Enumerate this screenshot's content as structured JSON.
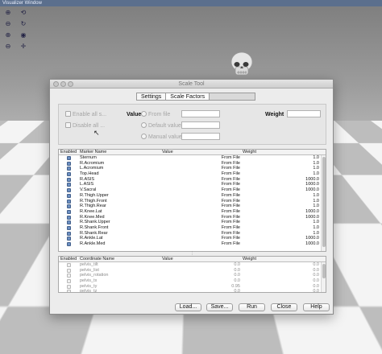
{
  "viz": {
    "title": "Visualizer Window",
    "toolbar_icons": [
      "zoom-in-icon",
      "rotate-icon",
      "zoom-out-icon",
      "refresh-icon",
      "zoom-in-icon",
      "camera-icon",
      "zoom-out-icon",
      "axes-icon"
    ],
    "floor_colors": {
      "light": "#f4f4f4",
      "dark": "#bdbdbd"
    }
  },
  "dialog": {
    "title": "Scale Tool",
    "tabs": [
      {
        "label": "Settings"
      },
      {
        "label": "Scale Factors"
      },
      {
        "label": ""
      }
    ],
    "settings": {
      "enable_all": "Enable all s...",
      "disable_all": "Disable all ...",
      "value_label": "Value",
      "from_file": "From file",
      "default_value": "Default value",
      "manual_value": "Manual value",
      "weight_label": "Weight"
    },
    "marker_table": {
      "headers": {
        "enabled": "Enabled",
        "name": "Marker Name",
        "value": "Value",
        "weight": "Weight"
      },
      "rows": [
        {
          "name": "Sternum",
          "value": "From File",
          "weight": "1.0"
        },
        {
          "name": "R.Acromium",
          "value": "From File",
          "weight": "1.0"
        },
        {
          "name": "L.Acromium",
          "value": "From File",
          "weight": "1.0"
        },
        {
          "name": "Top.Head",
          "value": "From File",
          "weight": "1.0"
        },
        {
          "name": "R.ASIS",
          "value": "From File",
          "weight": "1000.0"
        },
        {
          "name": "L.ASIS",
          "value": "From File",
          "weight": "1000.0"
        },
        {
          "name": "V.Sacral",
          "value": "From File",
          "weight": "1000.0"
        },
        {
          "name": "R.Thigh.Upper",
          "value": "From File",
          "weight": "1.0"
        },
        {
          "name": "R.Thigh.Front",
          "value": "From File",
          "weight": "1.0"
        },
        {
          "name": "R.Thigh.Rear",
          "value": "From File",
          "weight": "1.0"
        },
        {
          "name": "R.Knee.Lat",
          "value": "From File",
          "weight": "1000.0"
        },
        {
          "name": "R.Knee.Med",
          "value": "From File",
          "weight": "1000.0"
        },
        {
          "name": "R.Shank.Upper",
          "value": "From File",
          "weight": "1.0"
        },
        {
          "name": "R.Shank.Front",
          "value": "From File",
          "weight": "1.0"
        },
        {
          "name": "R.Shank.Rear",
          "value": "From File",
          "weight": "1.0"
        },
        {
          "name": "R.Ankle.Lat",
          "value": "From File",
          "weight": "1000.0"
        },
        {
          "name": "R.Ankle.Med",
          "value": "From File",
          "weight": "1000.0"
        }
      ]
    },
    "coord_table": {
      "headers": {
        "enabled": "Enabled",
        "name": "Coordinate Name",
        "value": "Value",
        "weight": "Weight"
      },
      "rows": [
        {
          "name": "pelvis_tilt",
          "value": "0.0",
          "weight": "0.0"
        },
        {
          "name": "pelvis_list",
          "value": "0.0",
          "weight": "0.0"
        },
        {
          "name": "pelvis_rotation",
          "value": "0.0",
          "weight": "0.0"
        },
        {
          "name": "pelvis_tx",
          "value": "0.0",
          "weight": "0.0"
        },
        {
          "name": "pelvis_ty",
          "value": "0.95",
          "weight": "0.0"
        },
        {
          "name": "pelvis_tz",
          "value": "0.0",
          "weight": "0.0"
        }
      ]
    },
    "buttons": {
      "load": "Load...",
      "save": "Save...",
      "run": "Run",
      "close": "Close",
      "help": "Help"
    }
  }
}
